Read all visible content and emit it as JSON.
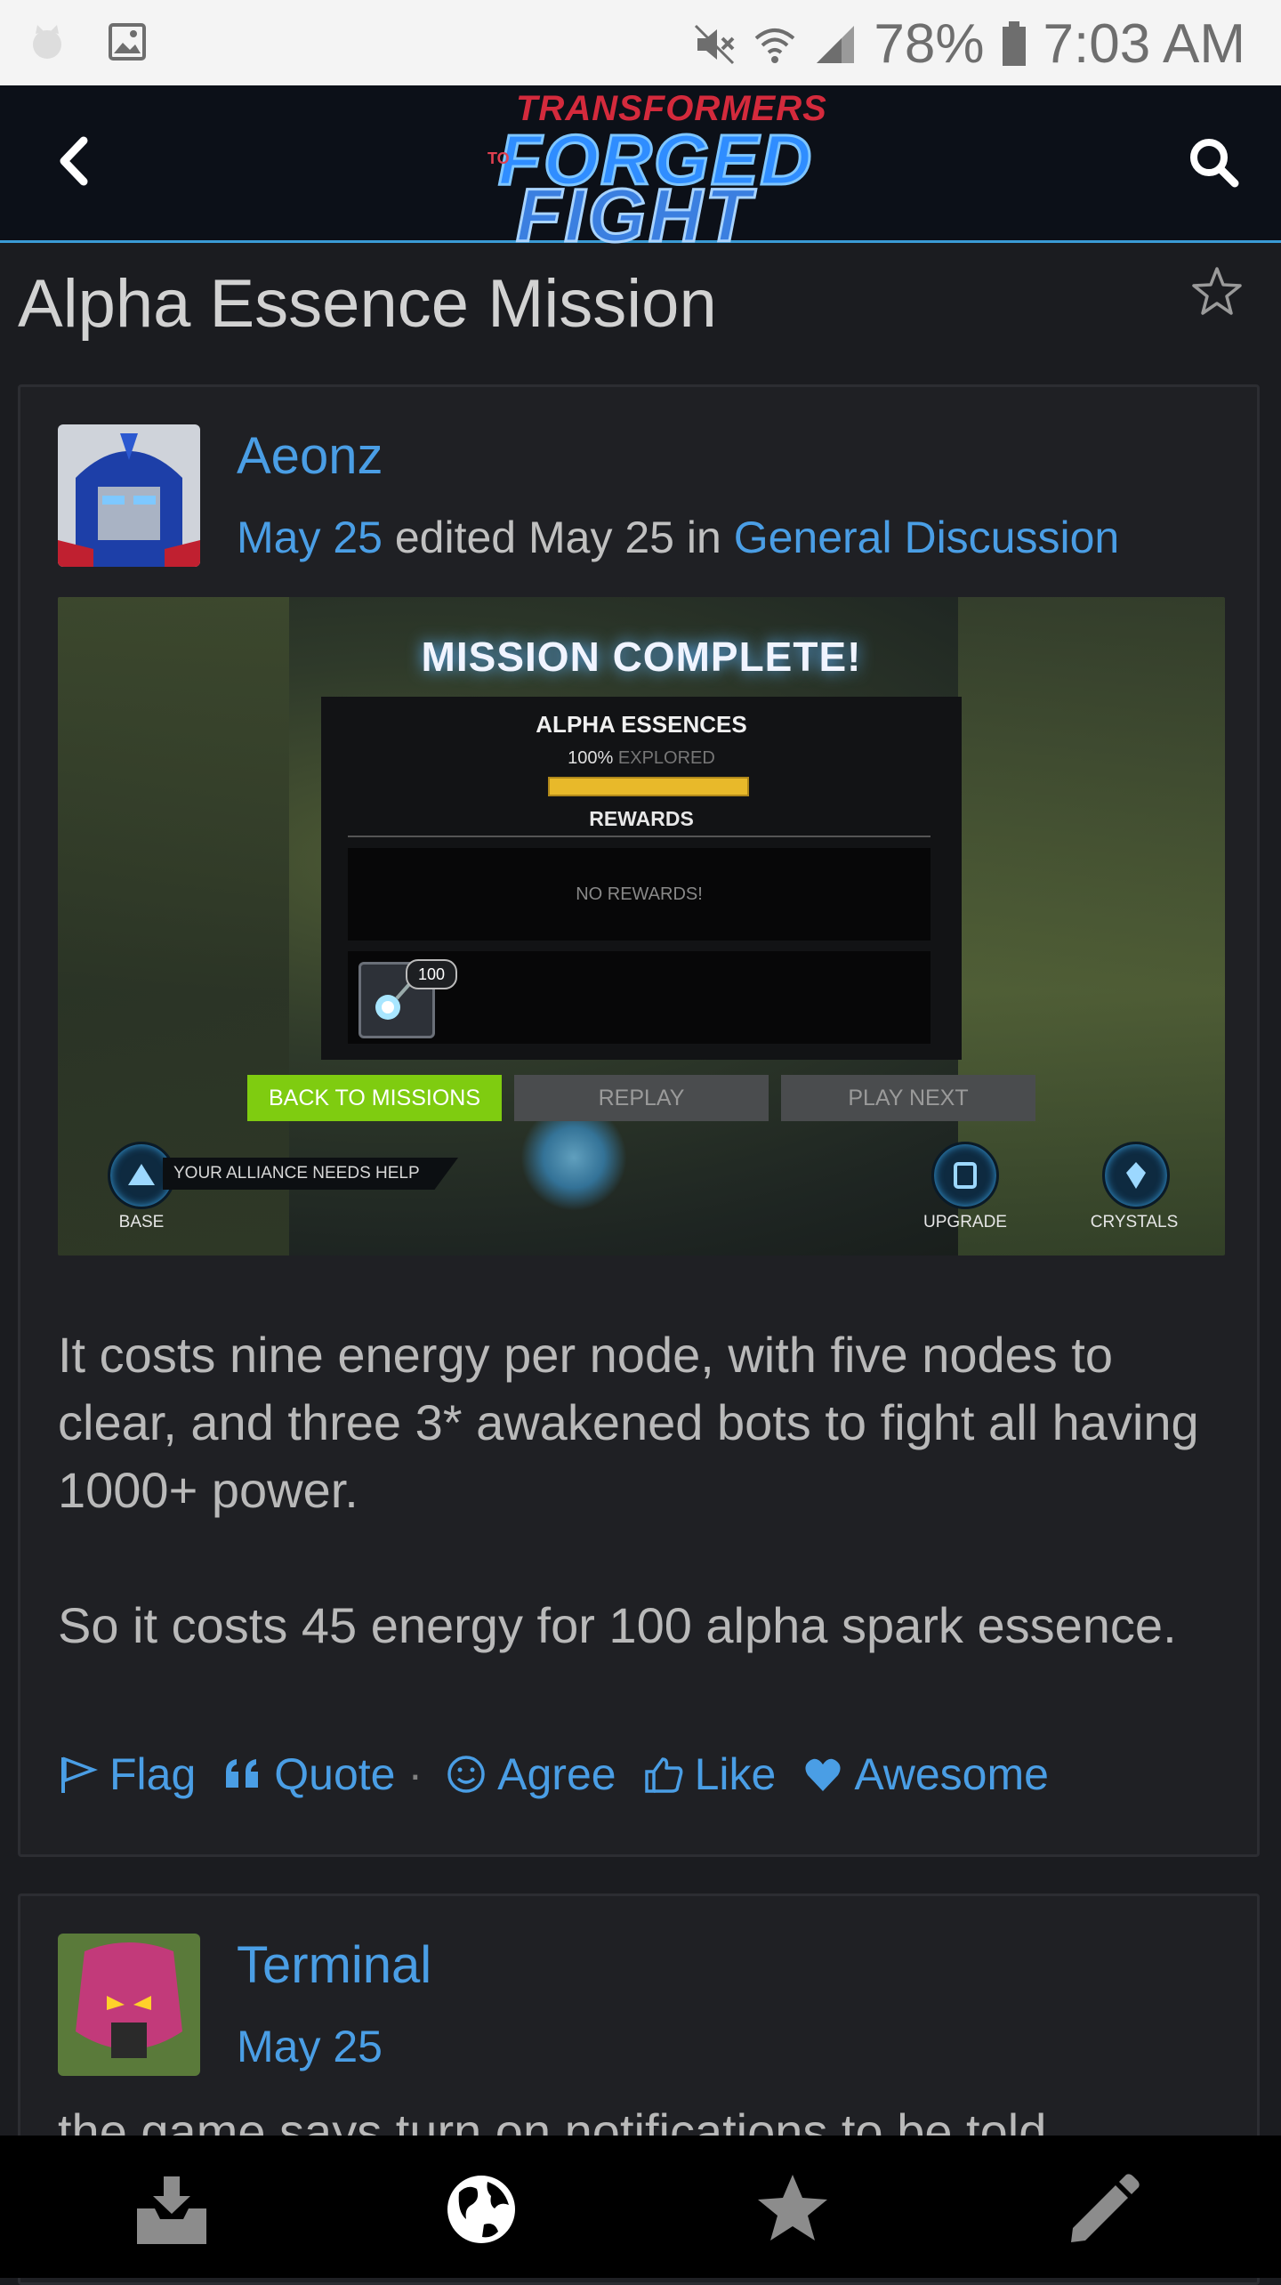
{
  "status_bar": {
    "battery": "78%",
    "time": "7:03 AM"
  },
  "header": {
    "logo": {
      "line1": "TRANSFORMERS",
      "line2": "FORGED",
      "line3": "TO",
      "line4": "FIGHT"
    }
  },
  "page": {
    "title": "Alpha Essence Mission"
  },
  "posts": [
    {
      "author": "Aeonz",
      "date": "May 25",
      "edited_text": "edited May 25 in",
      "category": "General Discussion",
      "screenshot": {
        "title": "MISSION COMPLETE!",
        "section": "ALPHA ESSENCES",
        "explored_pct": "100%",
        "explored_label": "EXPLORED",
        "progress": 1.0,
        "rewards_header": "REWARDS",
        "no_rewards": "NO REWARDS!",
        "item_count": "100",
        "buttons": [
          "BACK TO MISSIONS",
          "REPLAY",
          "PLAY NEXT"
        ],
        "alliance_alert": "YOUR ALLIANCE NEEDS HELP",
        "base_label": "BASE",
        "upgrade_label": "UPGRADE",
        "crystals_label": "CRYSTALS"
      },
      "paragraphs": [
        "It costs nine energy per node, with five nodes to clear, and three 3* awakened bots to fight all having 1000+ power.",
        "So it costs 45 energy for 100 alpha spark essence."
      ],
      "actions": {
        "flag": "Flag",
        "quote": "Quote",
        "separator": "·",
        "agree": "Agree",
        "like": "Like",
        "awesome": "Awesome"
      }
    },
    {
      "author": "Terminal",
      "date": "May 25",
      "snippet": "the game says turn on notifications to be told"
    }
  ],
  "colors": {
    "link": "#4a9ee5",
    "background": "#1b1c20",
    "accent_line": "#3a9bd5",
    "mission_button": "#7fcc10"
  }
}
